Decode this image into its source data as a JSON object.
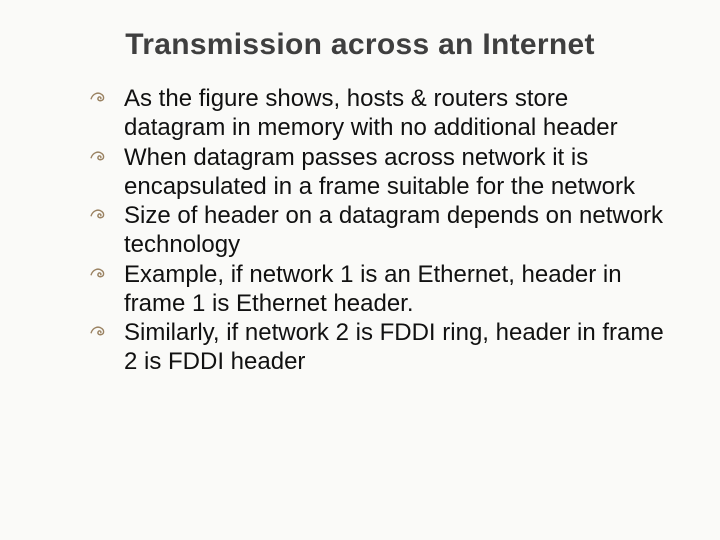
{
  "title": "Transmission across an Internet",
  "bullets": [
    "As the figure shows, hosts & routers store datagram in memory with no additional header",
    "When datagram passes across network it is encapsulated in a frame suitable for the network",
    "Size of header on a datagram depends on network technology",
    "Example, if network 1 is an Ethernet, header in frame 1 is Ethernet header.",
    "Similarly, if network 2 is FDDI ring, header in frame 2 is FDDI header"
  ]
}
